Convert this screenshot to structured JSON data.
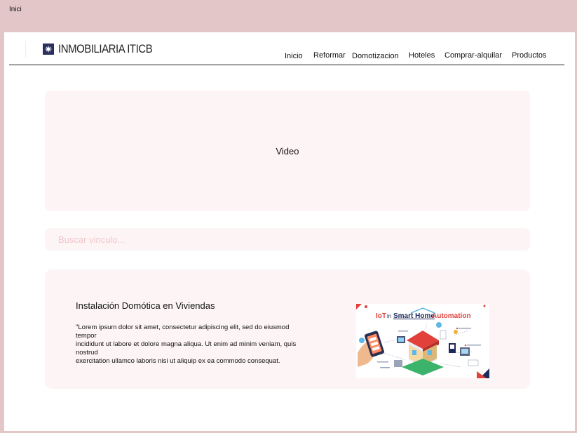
{
  "page": {
    "label": "Inici"
  },
  "header": {
    "brand": "INMOBILIARIA ITICB",
    "nav": [
      "Inicio",
      "Reformar",
      "Domotizacion",
      "Hoteles",
      "Comprar-alquilar",
      "Productos"
    ]
  },
  "video": {
    "label": "Video"
  },
  "search": {
    "placeholder": "Buscar vinculo..."
  },
  "card": {
    "title": "Instalación Domótica en Viviendas",
    "body_lines": [
      "\"Lorem ipsum dolor sit amet, consectetur adipiscing elit, sed do eiusmod tempor",
      "incididunt ut labore et dolore magna aliqua. Ut enim ad minim veniam, quis nostrud",
      "exercitation ullamco laboris nisi ut aliquip ex ea commodo consequat."
    ],
    "image": {
      "title_iot": "IoT",
      "title_in": "in",
      "title_smart_home": "Smart Home",
      "title_automation": "Automation"
    }
  },
  "colors": {
    "background": "#e3c6c7",
    "panel": "#fcf4f5",
    "brand_mark": "#2b2f5e",
    "placeholder": "#f0c7cc",
    "iot_red": "#e2403b",
    "iot_navy": "#1e2a5a"
  }
}
